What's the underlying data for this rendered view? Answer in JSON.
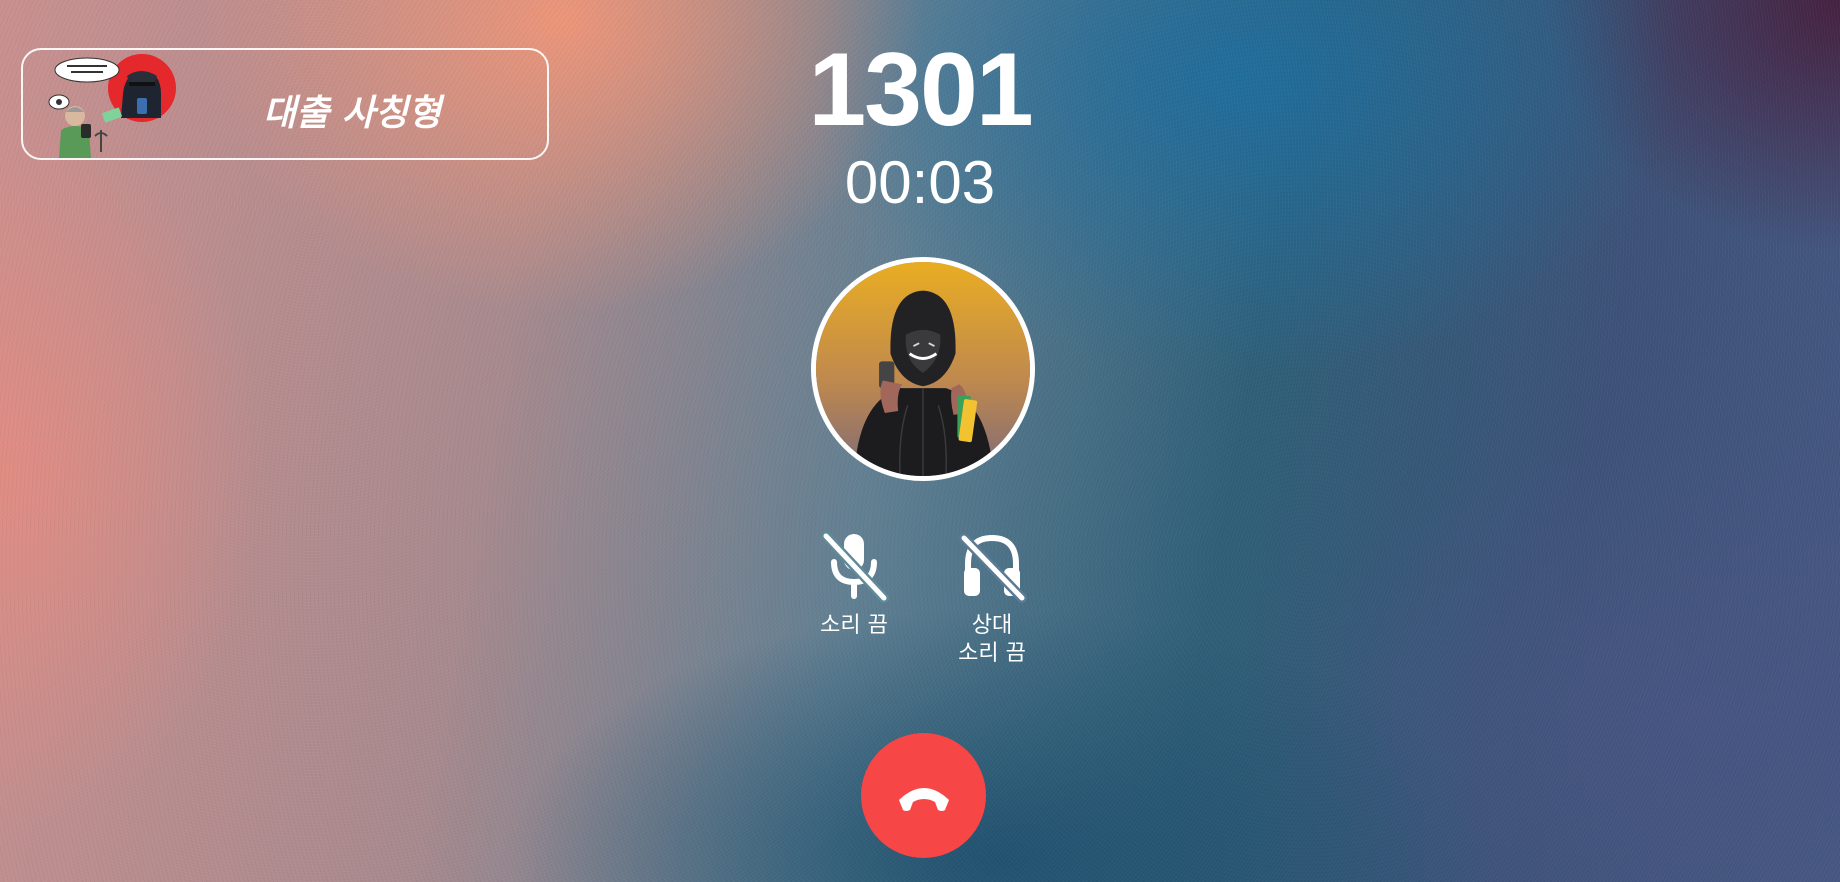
{
  "scenario": {
    "title": "대출 사칭형"
  },
  "call": {
    "number": "1301",
    "timer": "00:03"
  },
  "controls": {
    "mute_label": "소리 끔",
    "remote_mute_label": "상대\n소리 끔",
    "mute_icon": "mic-off-icon",
    "remote_mute_icon": "headset-off-icon",
    "end_call_icon": "phone-hangup-icon"
  },
  "colors": {
    "end_call": "#f74646",
    "text": "#ffffff"
  }
}
